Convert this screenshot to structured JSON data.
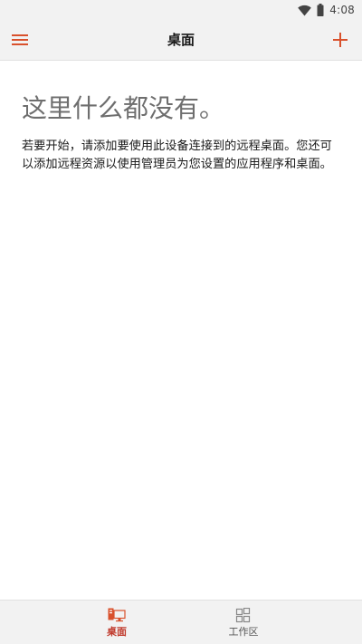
{
  "status_bar": {
    "time": "4:08",
    "icons": [
      "wifi-icon",
      "battery-icon"
    ]
  },
  "app_bar": {
    "title": "桌面",
    "left_icon": "menu-icon",
    "right_icon": "add-icon"
  },
  "empty_state": {
    "title": "这里什么都没有。",
    "body": "若要开始，请添加要使用此设备连接到的远程桌面。您还可以添加远程资源以使用管理员为您设置的应用程序和桌面。"
  },
  "bottom_nav": {
    "tabs": [
      {
        "label": "桌面",
        "icon": "desktop-icon",
        "selected": true
      },
      {
        "label": "工作区",
        "icon": "workspaces-icon",
        "selected": false
      }
    ]
  },
  "colors": {
    "accent": "#d9512c",
    "active_label": "#c0392b",
    "bar_background": "#f2f2f2",
    "title_gray": "#6e6e6e"
  }
}
